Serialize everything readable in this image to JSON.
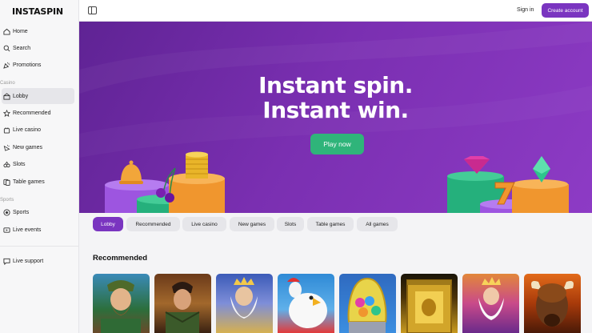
{
  "brand": {
    "logo": "INSTASPIN"
  },
  "sidebar": {
    "top_items": [
      {
        "label": "Home",
        "icon": "home-icon"
      },
      {
        "label": "Search",
        "icon": "search-icon"
      },
      {
        "label": "Promotions",
        "icon": "promotions-icon"
      }
    ],
    "casino_label": "Casino",
    "casino_items": [
      {
        "label": "Lobby",
        "icon": "lobby-icon",
        "active": true
      },
      {
        "label": "Recommended",
        "icon": "recommended-icon"
      },
      {
        "label": "Live casino",
        "icon": "live-casino-icon"
      },
      {
        "label": "New games",
        "icon": "new-games-icon"
      },
      {
        "label": "Slots",
        "icon": "slots-icon"
      },
      {
        "label": "Table games",
        "icon": "table-games-icon"
      }
    ],
    "sports_label": "Sports",
    "sports_items": [
      {
        "label": "Sports",
        "icon": "sports-icon"
      },
      {
        "label": "Live events",
        "icon": "live-events-icon"
      }
    ],
    "support": {
      "label": "Live support",
      "icon": "live-support-icon"
    }
  },
  "topbar": {
    "signin": "Sign in",
    "create_account": "Create account"
  },
  "hero": {
    "line1": "Instant spin.",
    "line2": "Instant win.",
    "cta": "Play now"
  },
  "categories": [
    "Lobby",
    "Recommended",
    "Live casino",
    "New games",
    "Slots",
    "Table games",
    "All games"
  ],
  "recommended": {
    "title": "Recommended",
    "games": [
      "game-1",
      "game-2",
      "game-3",
      "game-4",
      "game-5",
      "game-6",
      "game-7",
      "game-8"
    ]
  },
  "colors": {
    "accent": "#7a35c0",
    "cta": "#2fb47a",
    "hero": "#7a2fb1"
  }
}
